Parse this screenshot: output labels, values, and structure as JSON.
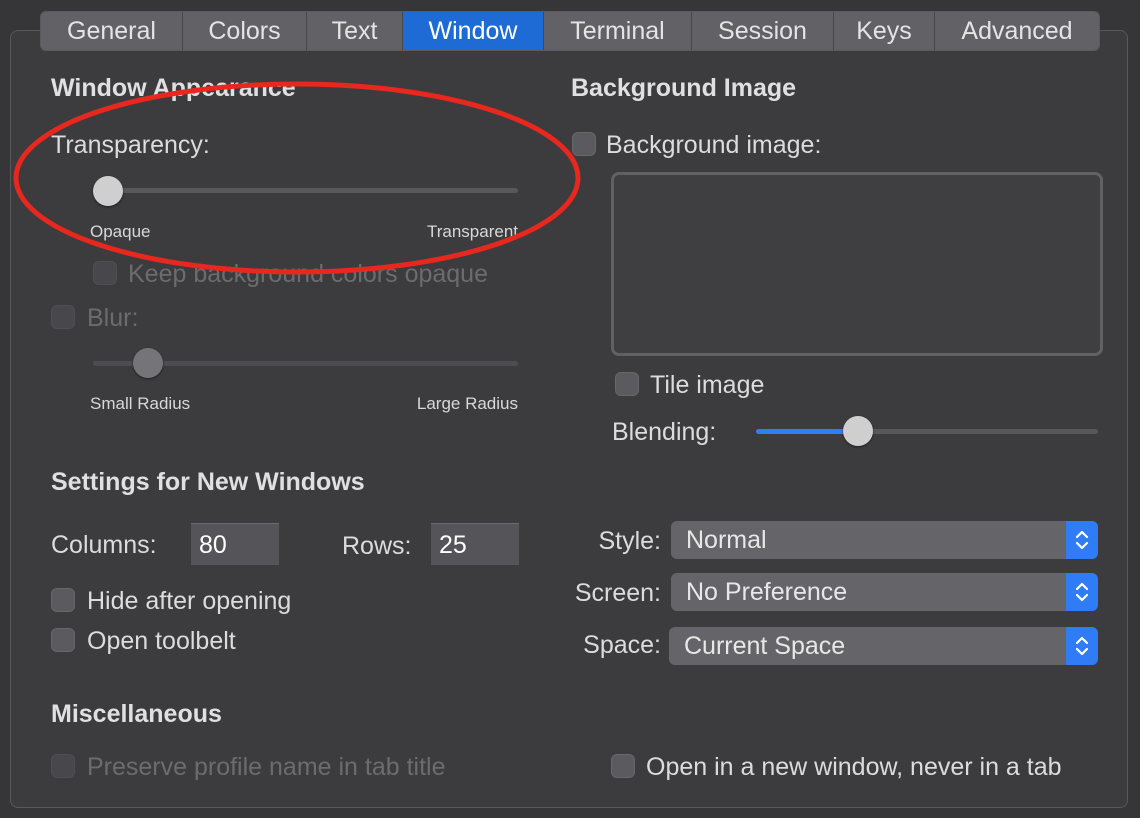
{
  "tabs": [
    "General",
    "Colors",
    "Text",
    "Window",
    "Terminal",
    "Session",
    "Keys",
    "Advanced"
  ],
  "active_tab": "Window",
  "window_appearance": {
    "heading": "Window Appearance",
    "transparency_label": "Transparency:",
    "transparency_min_label": "Opaque",
    "transparency_max_label": "Transparent",
    "transparency_value": 0,
    "keep_bg_opaque_label": "Keep background colors opaque",
    "blur_label": "Blur:",
    "blur_min_label": "Small Radius",
    "blur_max_label": "Large Radius",
    "blur_value": 0.1
  },
  "background_image": {
    "heading": "Background Image",
    "checkbox_label": "Background image:",
    "tile_label": "Tile image",
    "blending_label": "Blending:",
    "blending_value": 0.28
  },
  "new_windows": {
    "heading": "Settings for New Windows",
    "columns_label": "Columns:",
    "columns_value": "80",
    "rows_label": "Rows:",
    "rows_value": "25",
    "hide_after_opening_label": "Hide after opening",
    "open_toolbelt_label": "Open toolbelt",
    "style_label": "Style:",
    "style_value": "Normal",
    "screen_label": "Screen:",
    "screen_value": "No Preference",
    "space_label": "Space:",
    "space_value": "Current Space"
  },
  "misc": {
    "heading": "Miscellaneous",
    "preserve_profile_label": "Preserve profile name in tab title",
    "open_new_window_label": "Open in a new window, never in a tab"
  },
  "colors": {
    "accent": "#2d7ef7",
    "annotation": "#e8281e"
  }
}
